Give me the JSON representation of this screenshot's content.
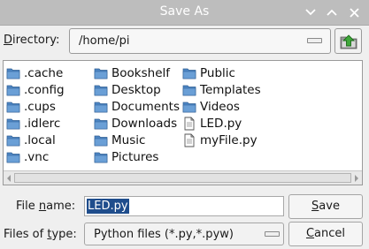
{
  "window": {
    "title": "Save As"
  },
  "directory": {
    "label_mnemonic": "D",
    "label_rest": "irectory:",
    "value": "/home/pi"
  },
  "files": [
    {
      "name": ".cache",
      "type": "folder"
    },
    {
      "name": ".config",
      "type": "folder"
    },
    {
      "name": ".cups",
      "type": "folder"
    },
    {
      "name": ".idlerc",
      "type": "folder"
    },
    {
      "name": ".local",
      "type": "folder"
    },
    {
      "name": ".vnc",
      "type": "folder"
    },
    {
      "name": "Bookshelf",
      "type": "folder"
    },
    {
      "name": "Desktop",
      "type": "folder"
    },
    {
      "name": "Documents",
      "type": "folder"
    },
    {
      "name": "Downloads",
      "type": "folder"
    },
    {
      "name": "Music",
      "type": "folder"
    },
    {
      "name": "Pictures",
      "type": "folder"
    },
    {
      "name": "Public",
      "type": "folder"
    },
    {
      "name": "Templates",
      "type": "folder"
    },
    {
      "name": "Videos",
      "type": "folder"
    },
    {
      "name": "LED.py",
      "type": "file"
    },
    {
      "name": "myFile.py",
      "type": "file"
    }
  ],
  "filename": {
    "label_pre": "File ",
    "label_mnemonic": "n",
    "label_post": "ame:",
    "value": "LED.py"
  },
  "filetype": {
    "label_pre": "Files of ",
    "label_mnemonic": "t",
    "label_post": "ype:",
    "value": "Python files (*.py,*.pyw)"
  },
  "buttons": {
    "save": {
      "mnemonic": "S",
      "rest": "ave"
    },
    "cancel": {
      "mnemonic": "C",
      "rest": "ancel"
    }
  },
  "colors": {
    "folder": "#4d86c4",
    "selection": "#1f4d8c",
    "titlebar": "#bdbdbd"
  }
}
